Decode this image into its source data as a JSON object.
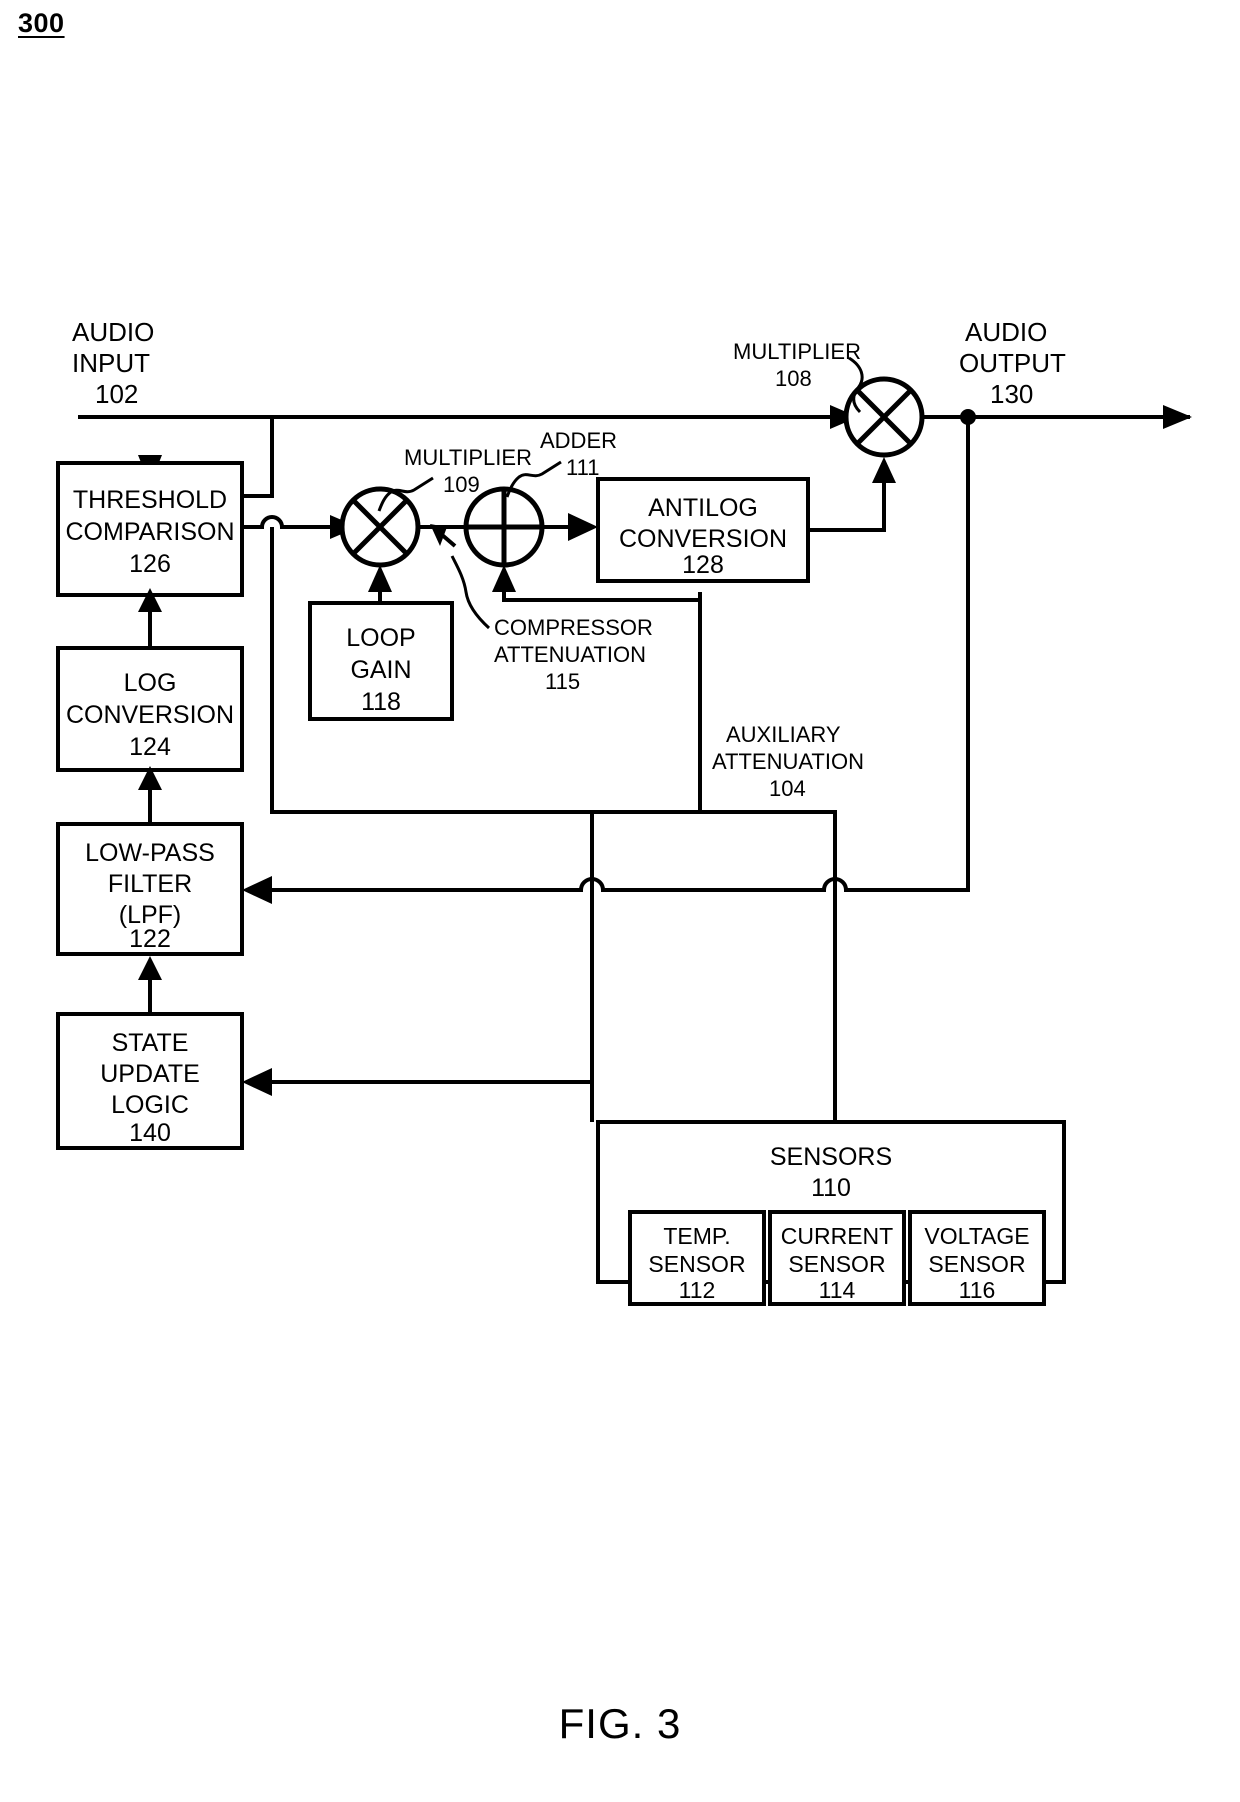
{
  "figure": {
    "number": "300",
    "caption": "FIG. 3"
  },
  "io": {
    "input": {
      "line1": "AUDIO",
      "line2": "INPUT",
      "ref": "102"
    },
    "output": {
      "line1": "AUDIO",
      "line2": "OUTPUT",
      "ref": "130"
    }
  },
  "blocks": {
    "threshold_comparison": {
      "line1": "THRESHOLD",
      "line2": "COMPARISON",
      "ref": "126"
    },
    "log_conversion": {
      "line1": "LOG",
      "line2": "CONVERSION",
      "ref": "124"
    },
    "low_pass_filter": {
      "line1": "LOW-PASS",
      "line2": "FILTER",
      "line3": "(LPF)",
      "ref": "122"
    },
    "state_update_logic": {
      "line1": "STATE",
      "line2": "UPDATE",
      "line3": "LOGIC",
      "ref": "140"
    },
    "loop_gain": {
      "line1": "LOOP",
      "line2": "GAIN",
      "ref": "118"
    },
    "antilog_conversion": {
      "line1": "ANTILOG",
      "line2": "CONVERSION",
      "ref": "128"
    },
    "sensors": {
      "line1": "SENSORS",
      "ref": "110"
    },
    "temp_sensor": {
      "line1": "TEMP.",
      "line2": "SENSOR",
      "ref": "112"
    },
    "current_sensor": {
      "line1": "CURRENT",
      "line2": "SENSOR",
      "ref": "114"
    },
    "voltage_sensor": {
      "line1": "VOLTAGE",
      "line2": "SENSOR",
      "ref": "116"
    }
  },
  "operators": {
    "multiplier_108": {
      "label": "MULTIPLIER",
      "ref": "108",
      "symbol": "x"
    },
    "multiplier_109": {
      "label": "MULTIPLIER",
      "ref": "109",
      "symbol": "x"
    },
    "adder_111": {
      "label": "ADDER",
      "ref": "111",
      "symbol": "+"
    }
  },
  "annotations": {
    "compressor_attenuation": {
      "line1": "COMPRESSOR",
      "line2": "ATTENUATION",
      "ref": "115"
    },
    "auxiliary_attenuation": {
      "line1": "AUXILIARY",
      "line2": "ATTENUATION",
      "ref": "104"
    }
  },
  "colors": {
    "stroke": "#000000",
    "background": "#ffffff"
  }
}
